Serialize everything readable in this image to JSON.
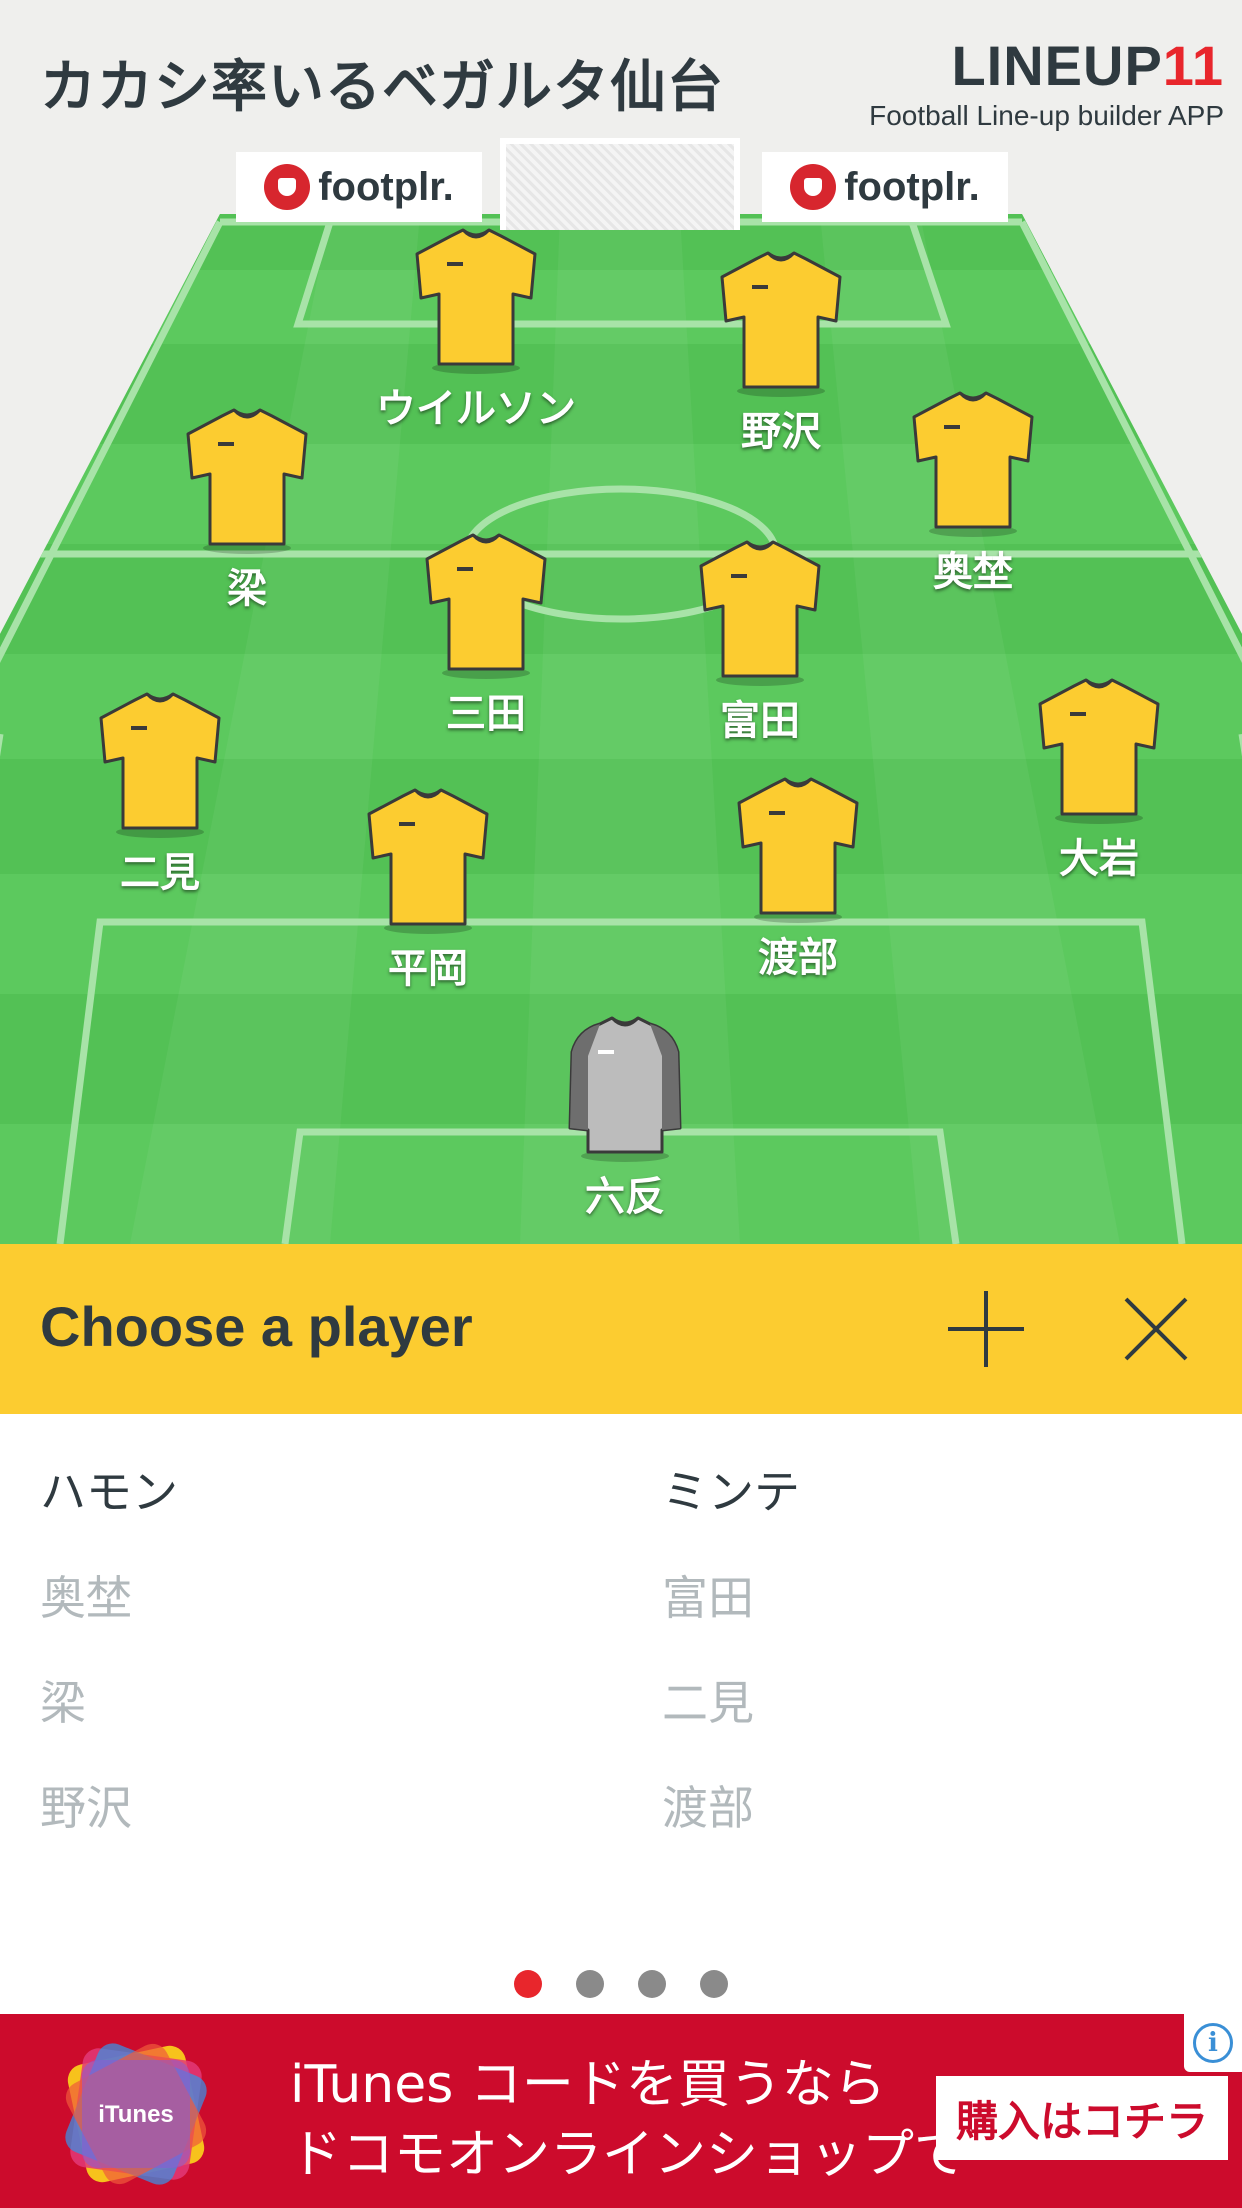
{
  "header": {
    "team_title": "カカシ率いるベガルタ仙台",
    "brand_name": "LINEUP",
    "brand_number": "11",
    "brand_tagline": "Football Line-up builder APP"
  },
  "sponsors": [
    {
      "label": "footplr."
    },
    {
      "label": "footplr."
    }
  ],
  "colors": {
    "pitch_light": "#6ad36b",
    "pitch_dark": "#4cba4f",
    "shirt": "#fccc30",
    "keeper": "#bcbcbc",
    "accent": "#fccc30",
    "ad_bg": "#cc0b2c",
    "active_dot": "#e8262c"
  },
  "players": [
    {
      "name": "ウイルソン",
      "kit": "outfield"
    },
    {
      "name": "野沢",
      "kit": "outfield"
    },
    {
      "name": "梁",
      "kit": "outfield"
    },
    {
      "name": "奥埜",
      "kit": "outfield"
    },
    {
      "name": "三田",
      "kit": "outfield"
    },
    {
      "name": "富田",
      "kit": "outfield"
    },
    {
      "name": "二見",
      "kit": "outfield"
    },
    {
      "name": "大岩",
      "kit": "outfield"
    },
    {
      "name": "平岡",
      "kit": "outfield"
    },
    {
      "name": "渡部",
      "kit": "outfield"
    },
    {
      "name": "六反",
      "kit": "goalkeeper"
    }
  ],
  "chooser": {
    "title": "Choose a player",
    "add_icon": "plus-icon",
    "close_icon": "close-icon"
  },
  "player_list": {
    "left": [
      {
        "name": "ハモン",
        "state": "available"
      },
      {
        "name": "奥埜",
        "state": "placed"
      },
      {
        "name": "梁",
        "state": "placed"
      },
      {
        "name": "野沢",
        "state": "placed"
      }
    ],
    "right": [
      {
        "name": "ミンテ",
        "state": "available"
      },
      {
        "name": "富田",
        "state": "placed"
      },
      {
        "name": "二見",
        "state": "placed"
      },
      {
        "name": "渡部",
        "state": "placed"
      }
    ]
  },
  "pagination": {
    "pages": 4,
    "current": 1
  },
  "ad": {
    "art_label": "iTunes",
    "line1": "iTunes コードを買うなら",
    "line2": "ドコモオンラインショップで",
    "cta": "購入はコチラ",
    "info_icon": "info-icon",
    "info_glyph": "i"
  }
}
